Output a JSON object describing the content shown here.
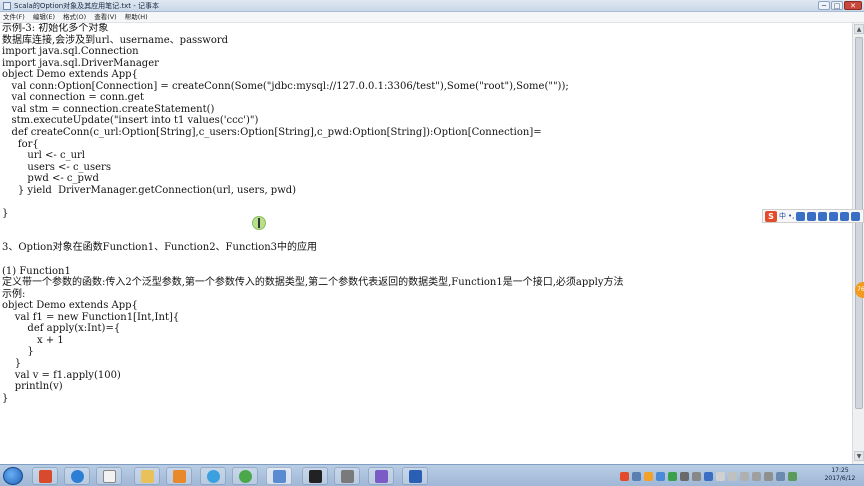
{
  "window": {
    "title": "Scala的Option对象及其应用笔记.txt - 记事本",
    "minimize": "─",
    "maximize": "□",
    "close": "✕"
  },
  "menu": [
    "文件(F)",
    "编辑(E)",
    "格式(O)",
    "查看(V)",
    "帮助(H)"
  ],
  "editor_lines": [
    "示例-3: 初始化多个对象",
    "数据库连接,会涉及到url、username、password",
    "import java.sql.Connection",
    "import java.sql.DriverManager",
    "object Demo extends App{",
    "   val conn:Option[Connection] = createConn(Some(\"jdbc:mysql://127.0.0.1:3306/test\"),Some(\"root\"),Some(\"\"));",
    "   val connection = conn.get",
    "   val stm = connection.createStatement()",
    "   stm.executeUpdate(\"insert into t1 values('ccc')\")",
    "   def createConn(c_url:Option[String],c_users:Option[String],c_pwd:Option[String]):Option[Connection]=",
    "     for{",
    "        url <- c_url",
    "        users <- c_users",
    "        pwd <- c_pwd",
    "     } yield  DriverManager.getConnection(url, users, pwd)",
    "",
    "}",
    "",
    "",
    "3、Option对象在函数Function1、Function2、Function3中的应用",
    "",
    "(1) Function1",
    "定义带一个参数的函数:传入2个泛型参数,第一个参数传入的数据类型,第二个参数代表返回的数据类型,Function1是一个接口,必须apply方法",
    "示例:",
    "object Demo extends App{",
    "    val f1 = new Function1[Int,Int]{",
    "        def apply(x:Int)={",
    "           x + 1",
    "        }",
    "    }",
    "    val v = f1.apply(100)",
    "    println(v)",
    "}"
  ],
  "ime": {
    "logo": "S",
    "mode": "中",
    "punct": "•,"
  },
  "side_badge": "76",
  "clock": {
    "time": "17:25",
    "date": "2017/6/12"
  },
  "colors": {
    "titlebar": "#c9d7e8",
    "taskbar": "#9fb8d6",
    "ime_accent": "#e44b2a"
  }
}
